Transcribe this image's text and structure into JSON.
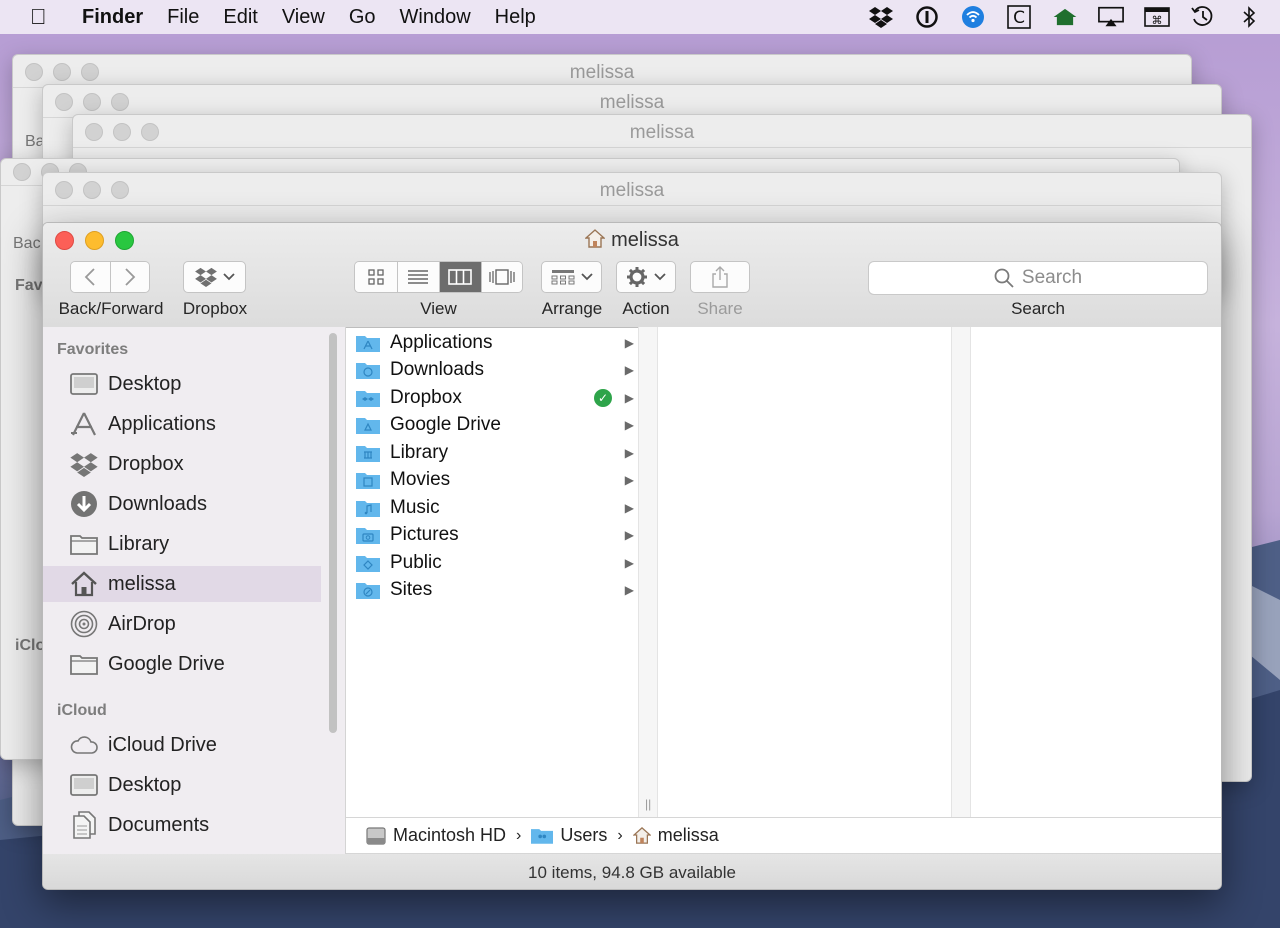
{
  "menubar": {
    "app": "Finder",
    "items": [
      "File",
      "Edit",
      "View",
      "Go",
      "Window",
      "Help"
    ],
    "status_icons": [
      "dropbox-icon",
      "1password-icon",
      "wifi-icon",
      "c-icon",
      "house-icon",
      "airplay-icon",
      "keyboard-icon",
      "time-machine-icon",
      "bluetooth-icon"
    ]
  },
  "background_windows": {
    "title": "melissa",
    "fragments": [
      "Bac",
      "Favo",
      "iClo"
    ]
  },
  "window": {
    "title": "melissa",
    "toolbar": {
      "back_forward_label": "Back/Forward",
      "dropbox_label": "Dropbox",
      "view_label": "View",
      "arrange_label": "Arrange",
      "action_label": "Action",
      "share_label": "Share",
      "search_label": "Search",
      "search_placeholder": "Search"
    },
    "sidebar": {
      "favorites_heading": "Favorites",
      "favorites": [
        {
          "label": "Desktop",
          "icon": "desktop-icon"
        },
        {
          "label": "Applications",
          "icon": "applications-icon"
        },
        {
          "label": "Dropbox",
          "icon": "dropbox-icon"
        },
        {
          "label": "Downloads",
          "icon": "downloads-icon"
        },
        {
          "label": "Library",
          "icon": "folder-icon"
        },
        {
          "label": "melissa",
          "icon": "home-icon",
          "selected": true
        },
        {
          "label": "AirDrop",
          "icon": "airdrop-icon"
        },
        {
          "label": "Google Drive",
          "icon": "folder-icon"
        }
      ],
      "icloud_heading": "iCloud",
      "icloud": [
        {
          "label": "iCloud Drive",
          "icon": "cloud-icon"
        },
        {
          "label": "Desktop",
          "icon": "desktop-icon"
        },
        {
          "label": "Documents",
          "icon": "documents-icon"
        }
      ]
    },
    "column1": [
      {
        "label": "Applications",
        "badge": false
      },
      {
        "label": "Downloads",
        "badge": false
      },
      {
        "label": "Dropbox",
        "badge": true
      },
      {
        "label": "Google Drive",
        "badge": false
      },
      {
        "label": "Library",
        "badge": false
      },
      {
        "label": "Movies",
        "badge": false
      },
      {
        "label": "Music",
        "badge": false
      },
      {
        "label": "Pictures",
        "badge": false
      },
      {
        "label": "Public",
        "badge": false
      },
      {
        "label": "Sites",
        "badge": false
      }
    ],
    "path": [
      "Macintosh HD",
      "Users",
      "melissa"
    ],
    "status_text": "10 items, 94.8 GB available"
  },
  "colors": {
    "folder_blue": "#62b7ec",
    "selection": "#e1d9e6",
    "close": "#fc5f57",
    "minimize": "#fdbc2e",
    "maximize": "#29c740",
    "sync_ok": "#2ea44a"
  }
}
